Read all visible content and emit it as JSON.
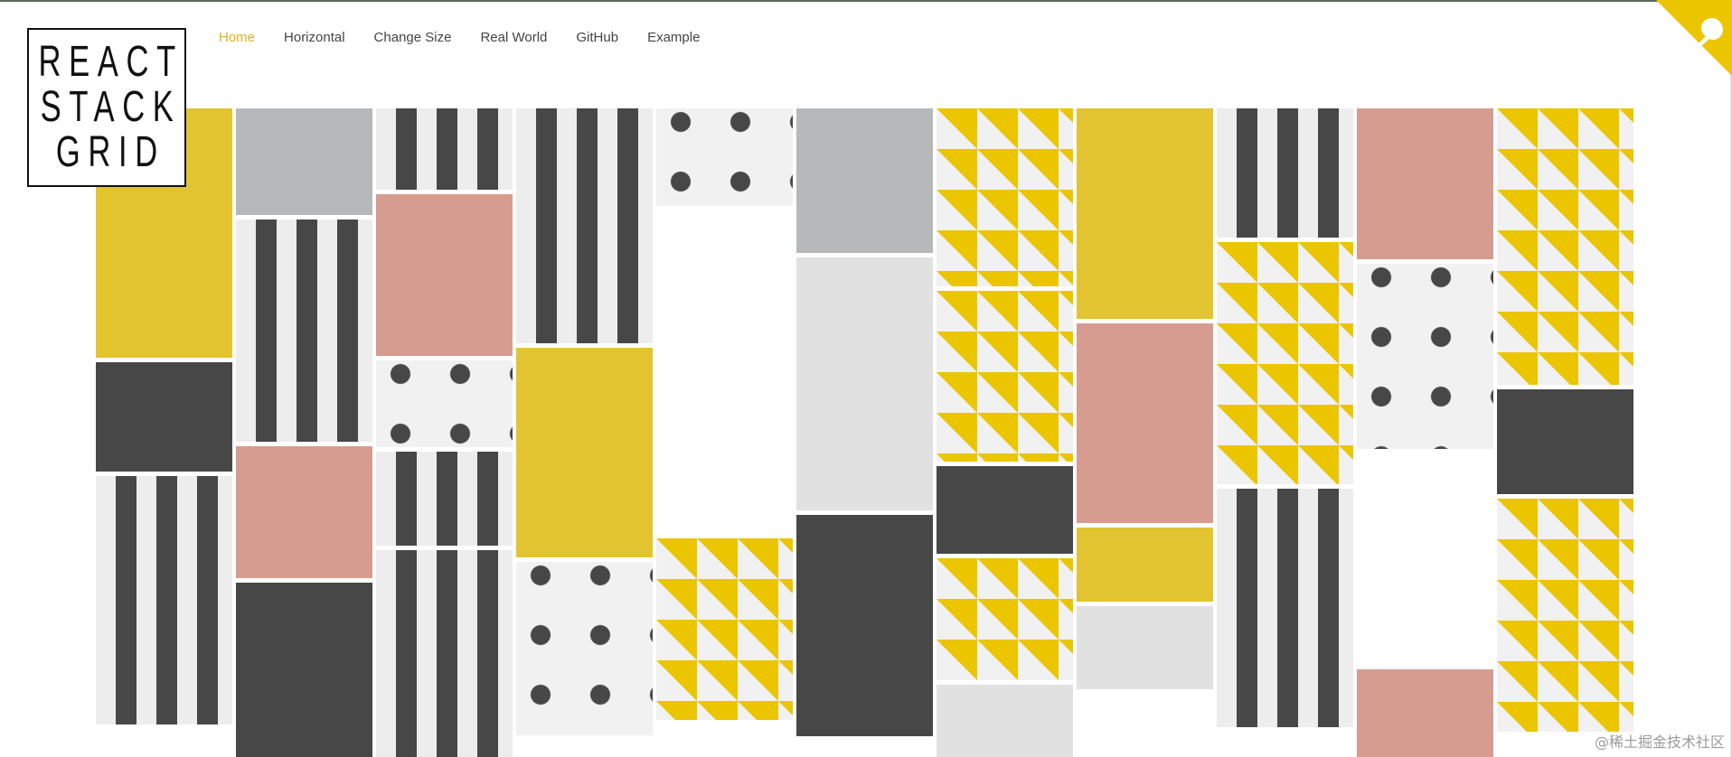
{
  "logo": {
    "lines": [
      "REACT",
      "STACK",
      "GRID"
    ]
  },
  "nav": {
    "items": [
      {
        "label": "Home",
        "active": true
      },
      {
        "label": "Horizontal",
        "active": false
      },
      {
        "label": "Change Size",
        "active": false
      },
      {
        "label": "Real World",
        "active": false
      },
      {
        "label": "GitHub",
        "active": false
      },
      {
        "label": "Example",
        "active": false
      }
    ]
  },
  "corner": {
    "icon": "github-octocat-icon",
    "color": "#ebc500"
  },
  "watermark": "@稀土掘金技术社区",
  "colors": {
    "accent": "#e2b11a",
    "yellow": "#e2c430",
    "dark": "#474748",
    "gray": "#b6b9ba",
    "light": "#e1e1e1",
    "pink": "#d69c90",
    "lavender": "#cbcbe2"
  },
  "grid": {
    "columns": [
      [
        "yellow",
        "dark",
        "stripe"
      ],
      [
        "gray",
        "stripe",
        "pink",
        "dark"
      ],
      [
        "stripe",
        "pink",
        "dots",
        "stripe",
        "stripe"
      ],
      [
        "stripe",
        "yellow",
        "dots"
      ],
      [
        "dots",
        "lavender",
        "lavender",
        "tri"
      ],
      [
        "gray",
        "light",
        "dark"
      ],
      [
        "tri",
        "tri",
        "dark",
        "tri",
        "light"
      ],
      [
        "yellow",
        "pink",
        "yellow",
        "light"
      ],
      [
        "stripe",
        "tri",
        "stripe"
      ],
      [
        "pink",
        "dots",
        "lavender",
        "pink"
      ],
      [
        "tri",
        "dark",
        "tri"
      ]
    ]
  }
}
